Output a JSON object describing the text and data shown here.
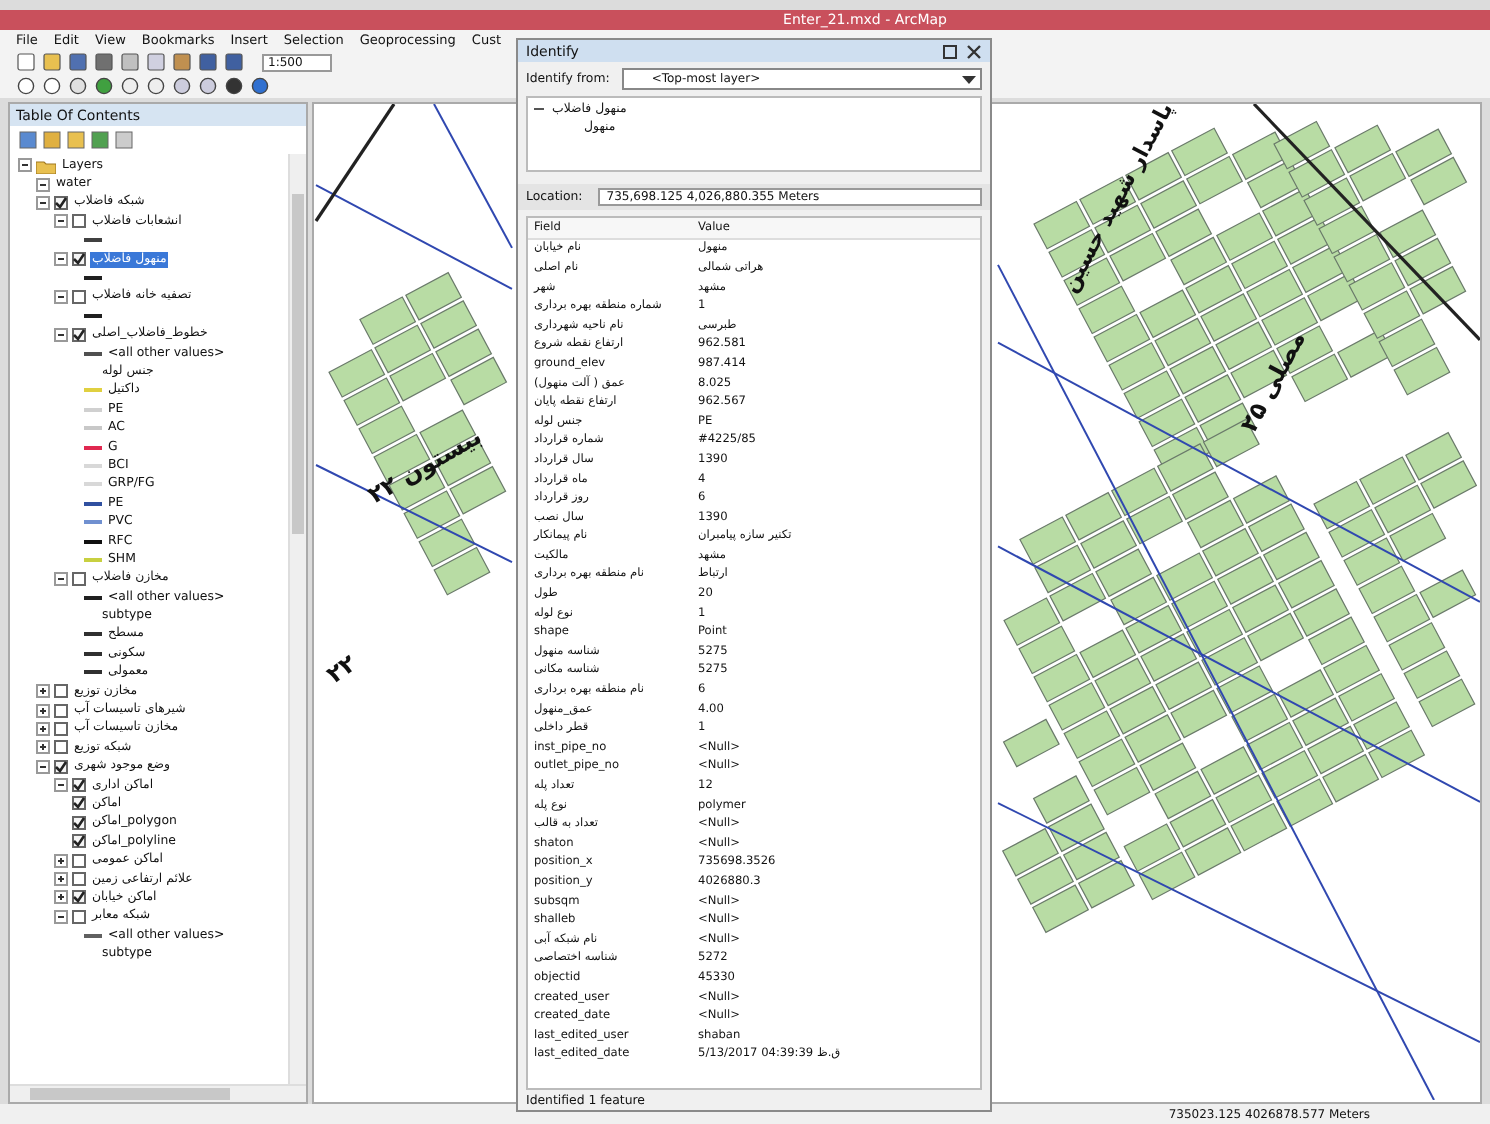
{
  "window": {
    "title": "Enter_21.mxd - ArcMap"
  },
  "menu": {
    "file": "File",
    "edit": "Edit",
    "view": "View",
    "bookmarks": "Bookmarks",
    "insert": "Insert",
    "selection": "Selection",
    "geoprocessing": "Geoprocessing",
    "last_cut": "Cust"
  },
  "toolbar": {
    "scale": "1:500"
  },
  "toc": {
    "title": "Table Of Contents",
    "items": [
      {
        "kind": "frame",
        "label": "Layers",
        "expanded": true,
        "children": [
          {
            "kind": "layer",
            "label": "water",
            "expanded": true
          },
          {
            "kind": "layer",
            "label": "شبکه فاضلاب",
            "checked": true,
            "expanded": true,
            "selected": false,
            "children": [
              {
                "kind": "layer",
                "label": "انشعابات فاضلاب",
                "checked": false,
                "expanded": true,
                "selected": false,
                "children": [
                  {
                    "kind": "legend",
                    "color": "#404040"
                  }
                ]
              },
              {
                "kind": "layer",
                "label": "منهول فاضلاب",
                "checked": true,
                "expanded": true,
                "selected": true,
                "children": [
                  {
                    "kind": "legend",
                    "color": "#202020"
                  }
                ]
              },
              {
                "kind": "layer",
                "label": "تصفیه خانه فاضلاب",
                "checked": false,
                "expanded": true,
                "selected": false,
                "children": [
                  {
                    "kind": "legend",
                    "color": "#202020"
                  }
                ]
              },
              {
                "kind": "layer",
                "label": "خطوط_فاضلاب_اصلی",
                "checked": true,
                "expanded": true,
                "selected": false,
                "children": [
                  {
                    "kind": "legend",
                    "label": "<all other values>",
                    "color": "#505050"
                  },
                  {
                    "kind": "heading",
                    "label": "جنس لوله"
                  },
                  {
                    "kind": "legend",
                    "label": "داکتیل",
                    "color": "#e0d040"
                  },
                  {
                    "kind": "legend",
                    "label": "PE",
                    "color": "#d0d0d0"
                  },
                  {
                    "kind": "legend",
                    "label": "AC",
                    "color": "#c8c8c8"
                  },
                  {
                    "kind": "legend",
                    "label": "G",
                    "color": "#e02850"
                  },
                  {
                    "kind": "legend",
                    "label": "BCI",
                    "color": "#d8d8d8"
                  },
                  {
                    "kind": "legend",
                    "label": "GRP/FG",
                    "color": "#d8d8d8"
                  },
                  {
                    "kind": "legend",
                    "label": "PE",
                    "color": "#3050a0"
                  },
                  {
                    "kind": "legend",
                    "label": "PVC",
                    "color": "#7090d0"
                  },
                  {
                    "kind": "legend",
                    "label": "RFC",
                    "color": "#101010"
                  },
                  {
                    "kind": "legend",
                    "label": "SHM",
                    "color": "#c8d040"
                  }
                ]
              },
              {
                "kind": "layer",
                "label": "مخازن فاضلاب",
                "checked": false,
                "expanded": true,
                "selected": false,
                "children": [
                  {
                    "kind": "legend",
                    "label": "<all other values>",
                    "color": "#202020"
                  },
                  {
                    "kind": "heading",
                    "label": "subtype"
                  },
                  {
                    "kind": "legend",
                    "label": "مسطح",
                    "color": "#303030"
                  },
                  {
                    "kind": "legend",
                    "label": "سکونی",
                    "color": "#303030"
                  },
                  {
                    "kind": "legend",
                    "label": "معمولی",
                    "color": "#303030"
                  }
                ]
              }
            ]
          },
          {
            "kind": "layer",
            "label": "مخازن توزیع",
            "checked": false,
            "expanded": false,
            "selected": false
          },
          {
            "kind": "layer",
            "label": "شیرهای تاسیسات آب",
            "checked": false,
            "expanded": false,
            "selected": false
          },
          {
            "kind": "layer",
            "label": "مخازن تاسیسات آب",
            "checked": false,
            "expanded": false,
            "selected": false
          },
          {
            "kind": "layer",
            "label": "شبکه توزیع",
            "checked": false,
            "expanded": false,
            "selected": false
          },
          {
            "kind": "layer",
            "label": "وضع موجود شهری",
            "checked": true,
            "expanded": true,
            "selected": false,
            "children": [
              {
                "kind": "layer",
                "label": "اماکن اداری",
                "checked": true,
                "expanded": true,
                "selected": false,
                "children": [
                  {
                    "kind": "layer",
                    "label": "اماکن",
                    "checked": true,
                    "selected": false
                  },
                  {
                    "kind": "layer",
                    "label": "اماکن_polygon",
                    "checked": true,
                    "selected": false
                  },
                  {
                    "kind": "layer",
                    "label": "اماکن_polyline",
                    "checked": true,
                    "selected": false
                  }
                ]
              },
              {
                "kind": "layer",
                "label": "اماکن عمومی",
                "checked": false,
                "expanded": false,
                "selected": false
              },
              {
                "kind": "layer",
                "label": "علائم ارتفاعی زمین",
                "checked": false,
                "expanded": false,
                "selected": false
              },
              {
                "kind": "layer",
                "label": "اماکن خیابان",
                "checked": true,
                "expanded": false,
                "selected": false
              },
              {
                "kind": "layer",
                "label": "شبکه معابر",
                "checked": false,
                "expanded": true,
                "selected": false,
                "children": [
                  {
                    "kind": "legend",
                    "label": "<all other values>",
                    "color": "#606060"
                  },
                  {
                    "kind": "heading",
                    "label": "subtype"
                  }
                ]
              }
            ]
          }
        ]
      }
    ]
  },
  "map": {
    "labels": [
      "پاسدار شهید حسین",
      "مصلی ۲۵",
      "بیستون ۲۲",
      "۲۲"
    ]
  },
  "identify": {
    "title": "Identify",
    "from_label": "Identify from:",
    "from_value": "<Top-most layer>",
    "results": [
      {
        "label": "منهول فاضلاب",
        "expanded": true,
        "children": [
          {
            "label": "منهول"
          }
        ]
      }
    ],
    "location_label": "Location:",
    "location": "735,698.125  4,026,880.355 Meters",
    "field_header": "Field",
    "value_header": "Value",
    "attributes": [
      {
        "field": "نام خیابان",
        "value": "منهول"
      },
      {
        "field": "نام اصلی",
        "value": "هراتی شمالی"
      },
      {
        "field": "شهر",
        "value": "مشهد"
      },
      {
        "field": "شماره منطقه بهره برداری",
        "value": "1"
      },
      {
        "field": "نام ناحیه شهرداری",
        "value": "طبرسی"
      },
      {
        "field": "ارتفاع نقطه شروع",
        "value": "962.581"
      },
      {
        "field": "ground_elev",
        "value": "987.414"
      },
      {
        "field": "عمق ( آلت منهول)",
        "value": "8.025"
      },
      {
        "field": "ارتفاع نقطه پایان",
        "value": "962.567"
      },
      {
        "field": "جنس لوله",
        "value": "PE"
      },
      {
        "field": "شماره قرارداد",
        "value": "#4225/85"
      },
      {
        "field": "سال قرارداد",
        "value": "1390"
      },
      {
        "field": "ماه قرارداد",
        "value": "4"
      },
      {
        "field": "روز قرارداد",
        "value": "6"
      },
      {
        "field": "سال نصب",
        "value": "1390"
      },
      {
        "field": "نام پیمانکار",
        "value": "تکنیر سازه پیامبران"
      },
      {
        "field": "مالکیت",
        "value": "مشهد"
      },
      {
        "field": "نام منطقه بهره برداری",
        "value": "ارتباط"
      },
      {
        "field": "طول",
        "value": "20"
      },
      {
        "field": "نوع لوله",
        "value": "1"
      },
      {
        "field": "shape",
        "value": "Point"
      },
      {
        "field": "شناسه منهول",
        "value": "5275"
      },
      {
        "field": "شناسه مکانی",
        "value": "5275"
      },
      {
        "field": "نام منطقه بهره برداری",
        "value": "6"
      },
      {
        "field": "عمق_منهول",
        "value": "4.00"
      },
      {
        "field": "قطر داخلی",
        "value": "1"
      },
      {
        "field": "inst_pipe_no",
        "value": "<Null>"
      },
      {
        "field": "outlet_pipe_no",
        "value": "<Null>"
      },
      {
        "field": "تعداد پله",
        "value": "12"
      },
      {
        "field": "نوع پله",
        "value": "polymer"
      },
      {
        "field": "تعداد به قالب",
        "value": "<Null>"
      },
      {
        "field": "shaton",
        "value": "<Null>"
      },
      {
        "field": "position_x",
        "value": "735698.3526"
      },
      {
        "field": "position_y",
        "value": "4026880.3"
      },
      {
        "field": "subsqm",
        "value": "<Null>"
      },
      {
        "field": "shalleb",
        "value": "<Null>"
      },
      {
        "field": "نام شبکه آبی",
        "value": "<Null>"
      },
      {
        "field": "شناسه اختصاصی",
        "value": "5272"
      },
      {
        "field": "objectid",
        "value": "45330"
      },
      {
        "field": "created_user",
        "value": "<Null>"
      },
      {
        "field": "created_date",
        "value": "<Null>"
      },
      {
        "field": "last_edited_user",
        "value": "shaban"
      },
      {
        "field": "last_edited_date",
        "value": "5/13/2017 04:39:39 ق.ظ"
      }
    ],
    "footer": "Identified 1 feature"
  },
  "status_bar": {
    "coordinates": "735023.125  4026878.577 Meters"
  }
}
